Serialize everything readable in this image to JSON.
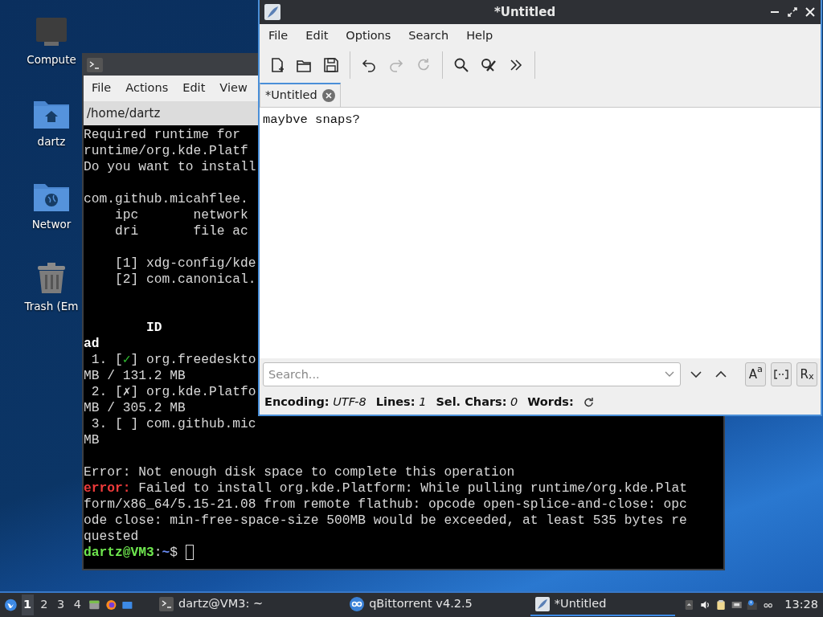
{
  "desktop_icons": [
    {
      "label": "Compute",
      "kind": "computer"
    },
    {
      "label": "dartz",
      "kind": "home"
    },
    {
      "label": "Networ",
      "kind": "network"
    },
    {
      "label": "Trash (Em",
      "kind": "trash"
    }
  ],
  "terminal": {
    "menu": [
      "File",
      "Actions",
      "Edit",
      "View"
    ],
    "path": "/home/dartz",
    "lines": [
      {
        "kind": "text",
        "segments": [
          {
            "text": "Required runtime for"
          }
        ]
      },
      {
        "kind": "text",
        "segments": [
          {
            "text": "runtime/org.kde.Platf"
          }
        ]
      },
      {
        "kind": "text",
        "segments": [
          {
            "text": "Do you want to install"
          }
        ]
      },
      {
        "kind": "blank"
      },
      {
        "kind": "text",
        "segments": [
          {
            "text": "com.github.micahflee."
          }
        ]
      },
      {
        "kind": "text",
        "segments": [
          {
            "text": "    ipc       network"
          }
        ]
      },
      {
        "kind": "text",
        "segments": [
          {
            "text": "    dri       file ac"
          }
        ]
      },
      {
        "kind": "blank"
      },
      {
        "kind": "text",
        "segments": [
          {
            "text": "    [1] xdg-config/kde"
          }
        ]
      },
      {
        "kind": "text",
        "segments": [
          {
            "text": "    [2] com.canonical."
          }
        ]
      },
      {
        "kind": "blank"
      },
      {
        "kind": "blank"
      },
      {
        "kind": "text",
        "segments": [
          {
            "text": "        ID",
            "kind": "bold"
          }
        ]
      },
      {
        "kind": "text",
        "segments": [
          {
            "text": "ad",
            "kind": "bold"
          }
        ]
      },
      {
        "kind": "text",
        "segments": [
          {
            "text": " 1. ["
          },
          {
            "text": "✓",
            "kind": "ok"
          },
          {
            "text": "] org.freedeskto"
          }
        ]
      },
      {
        "kind": "text",
        "segments": [
          {
            "text": "MB / 131.2 MB"
          }
        ]
      },
      {
        "kind": "text",
        "segments": [
          {
            "text": " 2. [✗] org.kde.Platfo"
          }
        ]
      },
      {
        "kind": "text",
        "segments": [
          {
            "text": "MB / 305.2 MB"
          }
        ]
      },
      {
        "kind": "text",
        "segments": [
          {
            "text": " 3. [ ] com.github.mic"
          }
        ]
      },
      {
        "kind": "text",
        "segments": [
          {
            "text": "MB"
          }
        ]
      },
      {
        "kind": "blank"
      },
      {
        "kind": "text",
        "segments": [
          {
            "text": "Error: Not enough disk space to complete this operation"
          }
        ]
      },
      {
        "kind": "text",
        "segments": [
          {
            "text": "error:",
            "kind": "error"
          },
          {
            "text": " Failed to install org.kde.Platform: While pulling runtime/org.kde.Plat"
          }
        ]
      },
      {
        "kind": "text",
        "segments": [
          {
            "text": "form/x86_64/5.15-21.08 from remote flathub: opcode open-splice-and-close: opc"
          }
        ]
      },
      {
        "kind": "text",
        "segments": [
          {
            "text": "ode close: min-free-space-size 500MB would be exceeded, at least 535 bytes re"
          }
        ]
      },
      {
        "kind": "text",
        "segments": [
          {
            "text": "quested"
          }
        ]
      },
      {
        "kind": "text",
        "cursor": true,
        "segments": [
          {
            "text": "dartz@VM3",
            "kind": "user"
          },
          {
            "text": ":"
          },
          {
            "text": "~",
            "kind": "path"
          },
          {
            "text": "$ "
          }
        ]
      }
    ]
  },
  "editor": {
    "title": "*Untitled",
    "menu": [
      "File",
      "Edit",
      "Options",
      "Search",
      "Help"
    ],
    "toolbar": [
      {
        "kind": "new",
        "disabled": false
      },
      {
        "kind": "open",
        "disabled": false
      },
      {
        "kind": "save",
        "disabled": false
      },
      {
        "kind": "sep"
      },
      {
        "kind": "undo",
        "disabled": false
      },
      {
        "kind": "redo",
        "disabled": true
      },
      {
        "kind": "reload",
        "disabled": true
      },
      {
        "kind": "sep"
      },
      {
        "kind": "find",
        "disabled": false
      },
      {
        "kind": "replace",
        "disabled": false
      },
      {
        "kind": "more",
        "disabled": false
      },
      {
        "kind": "sep"
      }
    ],
    "tabs": [
      {
        "label": "*Untitled",
        "selected": true
      }
    ],
    "text": "maybve snaps?",
    "search": {
      "placeholder": "Search..."
    },
    "search_options": [
      {
        "kind": "case",
        "label": "A$^{a}$"
      },
      {
        "kind": "word"
      },
      {
        "kind": "regex",
        "label": "R$_{x}$"
      }
    ],
    "status": [
      {
        "label": "Encoding:",
        "value": "UTF-8"
      },
      {
        "label": "Lines:",
        "value": "1"
      },
      {
        "label": "Sel. Chars:",
        "value": "0"
      },
      {
        "label": "Words:"
      }
    ]
  },
  "taskbar": {
    "workspaces": [
      {
        "label": "1",
        "selected": true
      },
      {
        "label": "2",
        "selected": false
      },
      {
        "label": "3",
        "selected": false
      },
      {
        "label": "4",
        "selected": false
      }
    ],
    "launchers": [
      {
        "kind": "files"
      },
      {
        "kind": "browser"
      },
      {
        "kind": "desktop"
      }
    ],
    "tasks": [
      {
        "label": "dartz@VM3: ~",
        "kind": "terminal",
        "selected": false
      },
      {
        "label": "qBittorrent v4.2.5",
        "kind": "torrent",
        "selected": false
      },
      {
        "label": "*Untitled",
        "kind": "editor",
        "selected": true
      }
    ],
    "tray": [
      {
        "kind": "expand"
      },
      {
        "kind": "volume"
      },
      {
        "kind": "clipboard"
      },
      {
        "kind": "network"
      },
      {
        "kind": "notify"
      },
      {
        "kind": "torrent"
      }
    ],
    "clock": "13:28"
  }
}
